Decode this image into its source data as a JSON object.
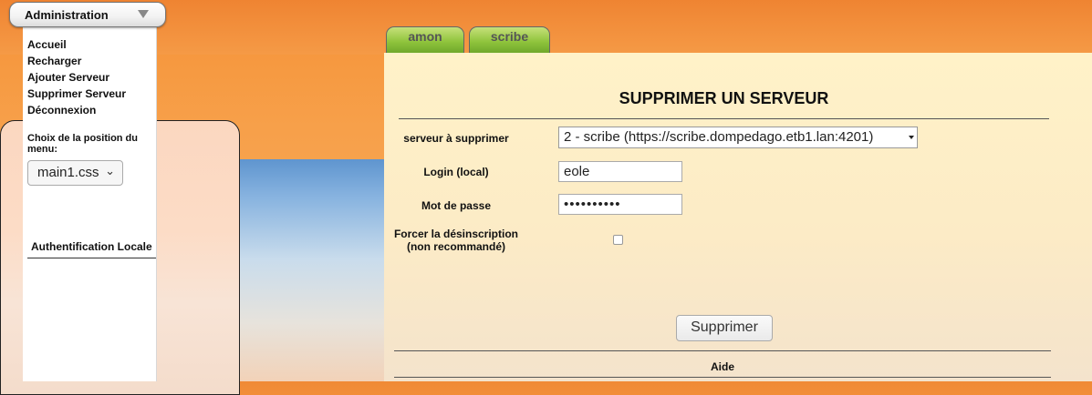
{
  "admin_menu": {
    "title": "Administration",
    "links": [
      "Accueil",
      "Recharger",
      "Ajouter Serveur",
      "Supprimer Serveur",
      "Déconnexion"
    ]
  },
  "menu_position": {
    "label": "Choix de la position du menu:",
    "selected": "main1.css"
  },
  "auth_section": "Authentification Locale",
  "tabs": [
    "amon",
    "scribe"
  ],
  "form": {
    "title": "SUPPRIMER UN SERVEUR",
    "server_label": "serveur à supprimer",
    "server_value": "2 - scribe (https://scribe.dompedago.etb1.lan:4201)",
    "login_label": "Login (local)",
    "login_value": "eole",
    "password_label": "Mot de passe",
    "password_value": "••••••••••",
    "force_label_line1": "Forcer la désinscription",
    "force_label_line2": "(non recommandé)",
    "force_checked": false,
    "submit_label": "Supprimer"
  },
  "aide_label": "Aide",
  "colors": {
    "orange_bg": "#f08a36",
    "content_bg": "#fff2c8",
    "tab_green": "#8fc43c"
  }
}
